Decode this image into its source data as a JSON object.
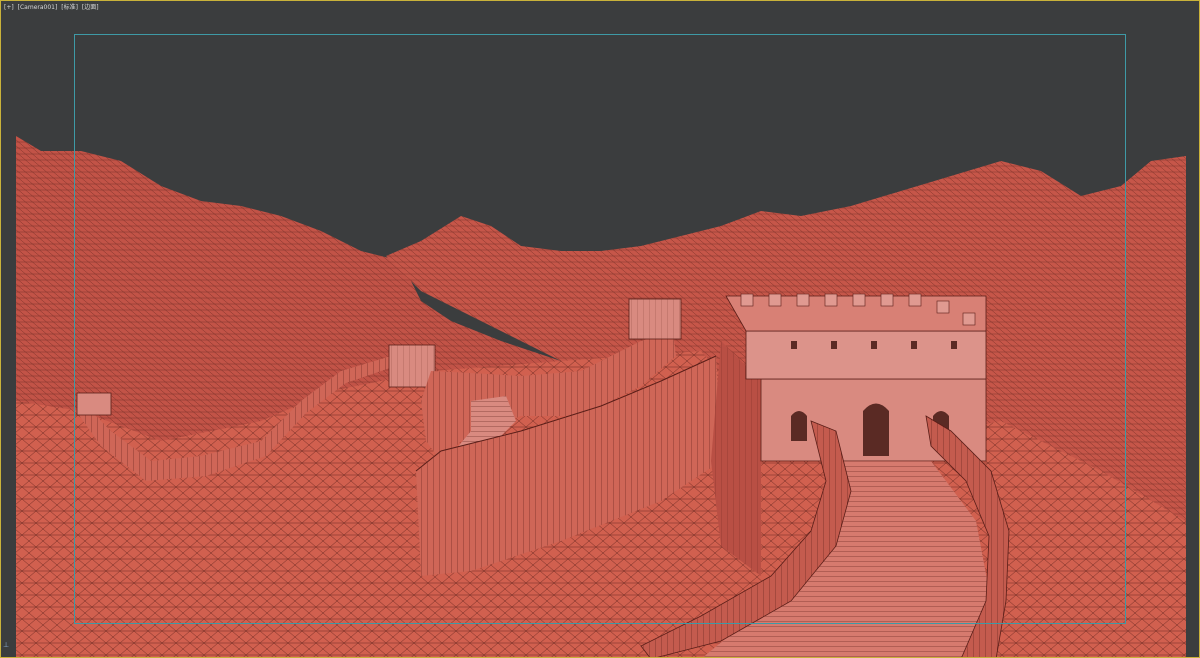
{
  "viewport": {
    "label_parts": [
      "[+]",
      "[Camera001]",
      "[标准]",
      "[边面]"
    ],
    "axis_gizmo_icon": "axis-gizmo-icon"
  },
  "colors": {
    "background": "#3b3d3e",
    "terrain": "#c9584a",
    "terrain_dark": "#a9443a",
    "wire": "#5a1e18",
    "wall": "#d36a5c",
    "wall_shadow": "#9c4036",
    "tower": "#d98a80",
    "frame_border": "#c9b23a",
    "safe_frame": "#3e9aa6"
  }
}
